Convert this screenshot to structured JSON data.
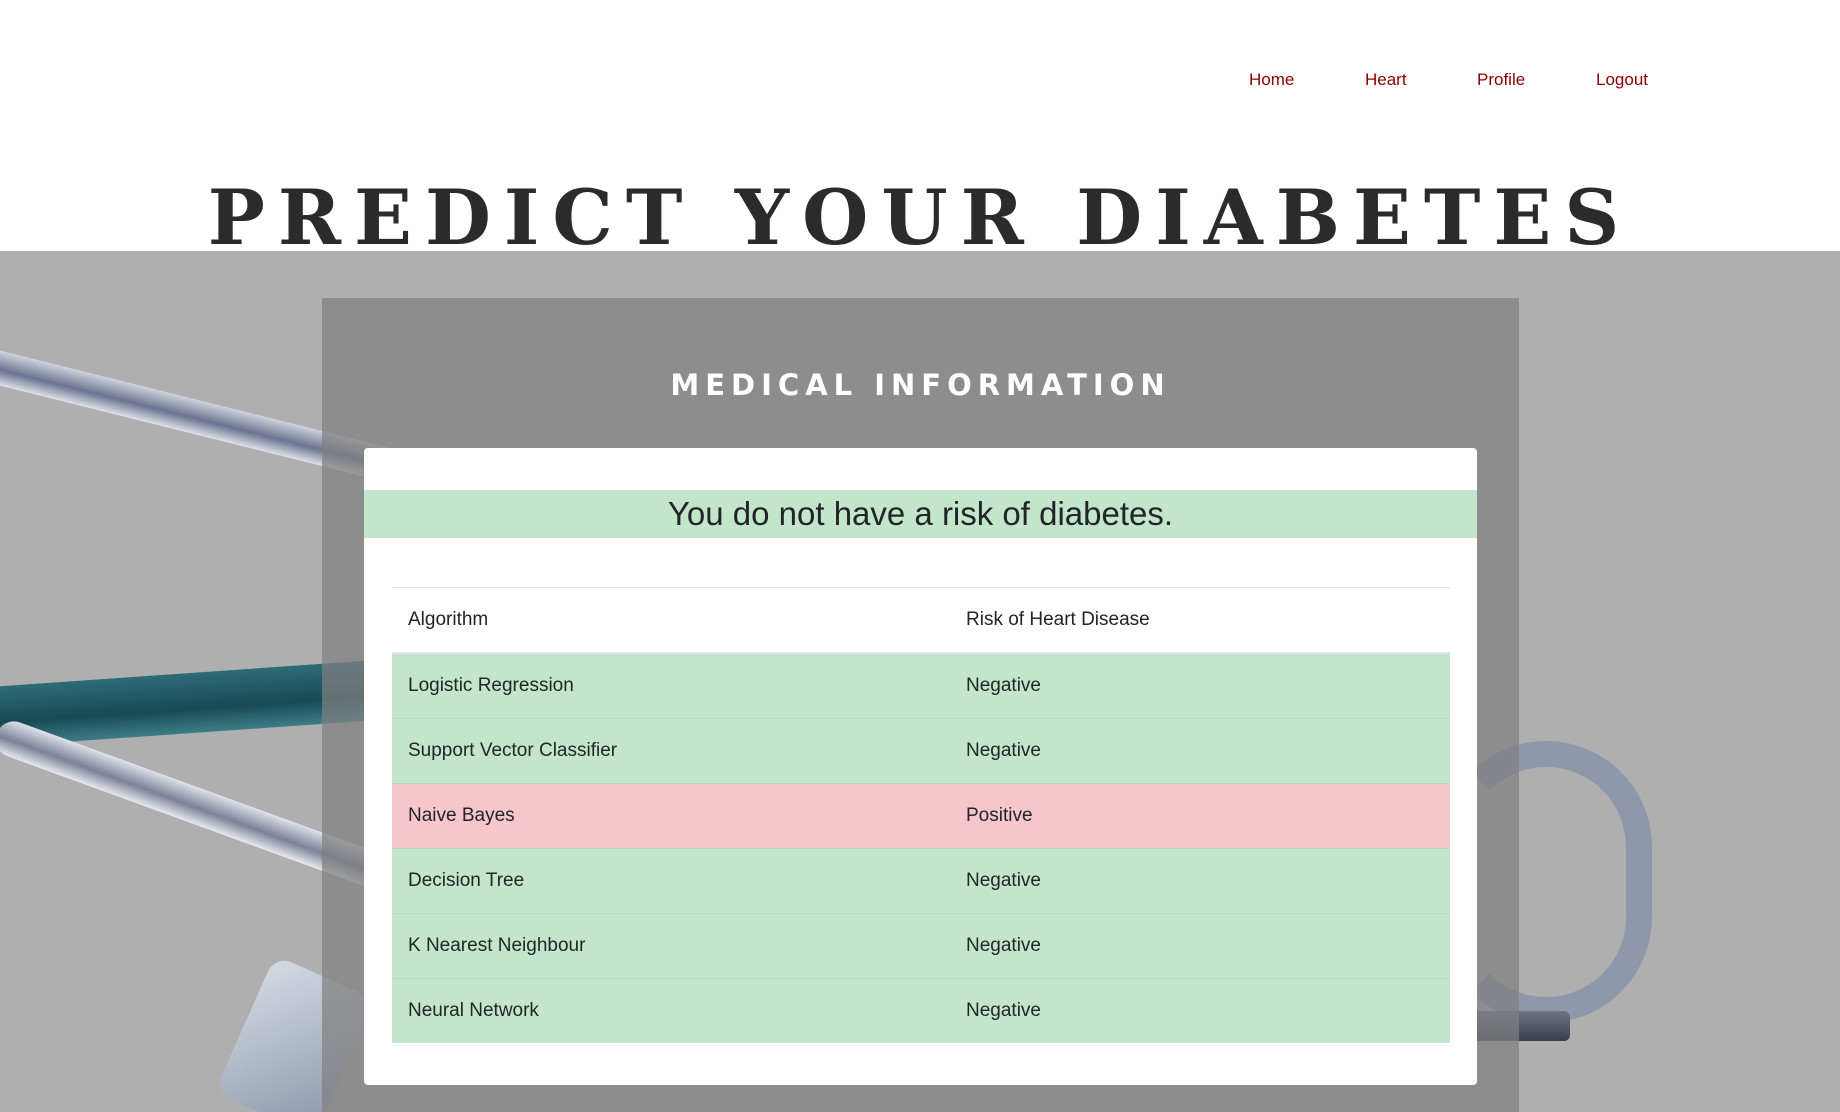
{
  "nav": {
    "items": [
      {
        "label": "Home"
      },
      {
        "label": "Heart"
      },
      {
        "label": "Profile"
      },
      {
        "label": "Logout"
      }
    ],
    "link_color": "#8b0000"
  },
  "hero": {
    "title": "PREDICT YOUR DIABETES DISEASE"
  },
  "panel": {
    "title": "MEDICAL INFORMATION"
  },
  "result": {
    "message": "You do not have a risk of diabetes.",
    "color": "#c3e6cb"
  },
  "table": {
    "headers": [
      "Algorithm",
      "Risk of Heart Disease"
    ],
    "rows": [
      {
        "algorithm": "Logistic Regression",
        "risk": "Negative",
        "status": "negative"
      },
      {
        "algorithm": "Support Vector Classifier",
        "risk": "Negative",
        "status": "negative"
      },
      {
        "algorithm": "Naive Bayes",
        "risk": "Positive",
        "status": "positive"
      },
      {
        "algorithm": "Decision Tree",
        "risk": "Negative",
        "status": "negative"
      },
      {
        "algorithm": "K Nearest Neighbour",
        "risk": "Negative",
        "status": "negative"
      },
      {
        "algorithm": "Neural Network",
        "risk": "Negative",
        "status": "negative"
      }
    ],
    "colors": {
      "negative": "#c3e6cb",
      "positive": "#f5c6cb"
    }
  },
  "background": {
    "image": "stethoscope-image"
  }
}
